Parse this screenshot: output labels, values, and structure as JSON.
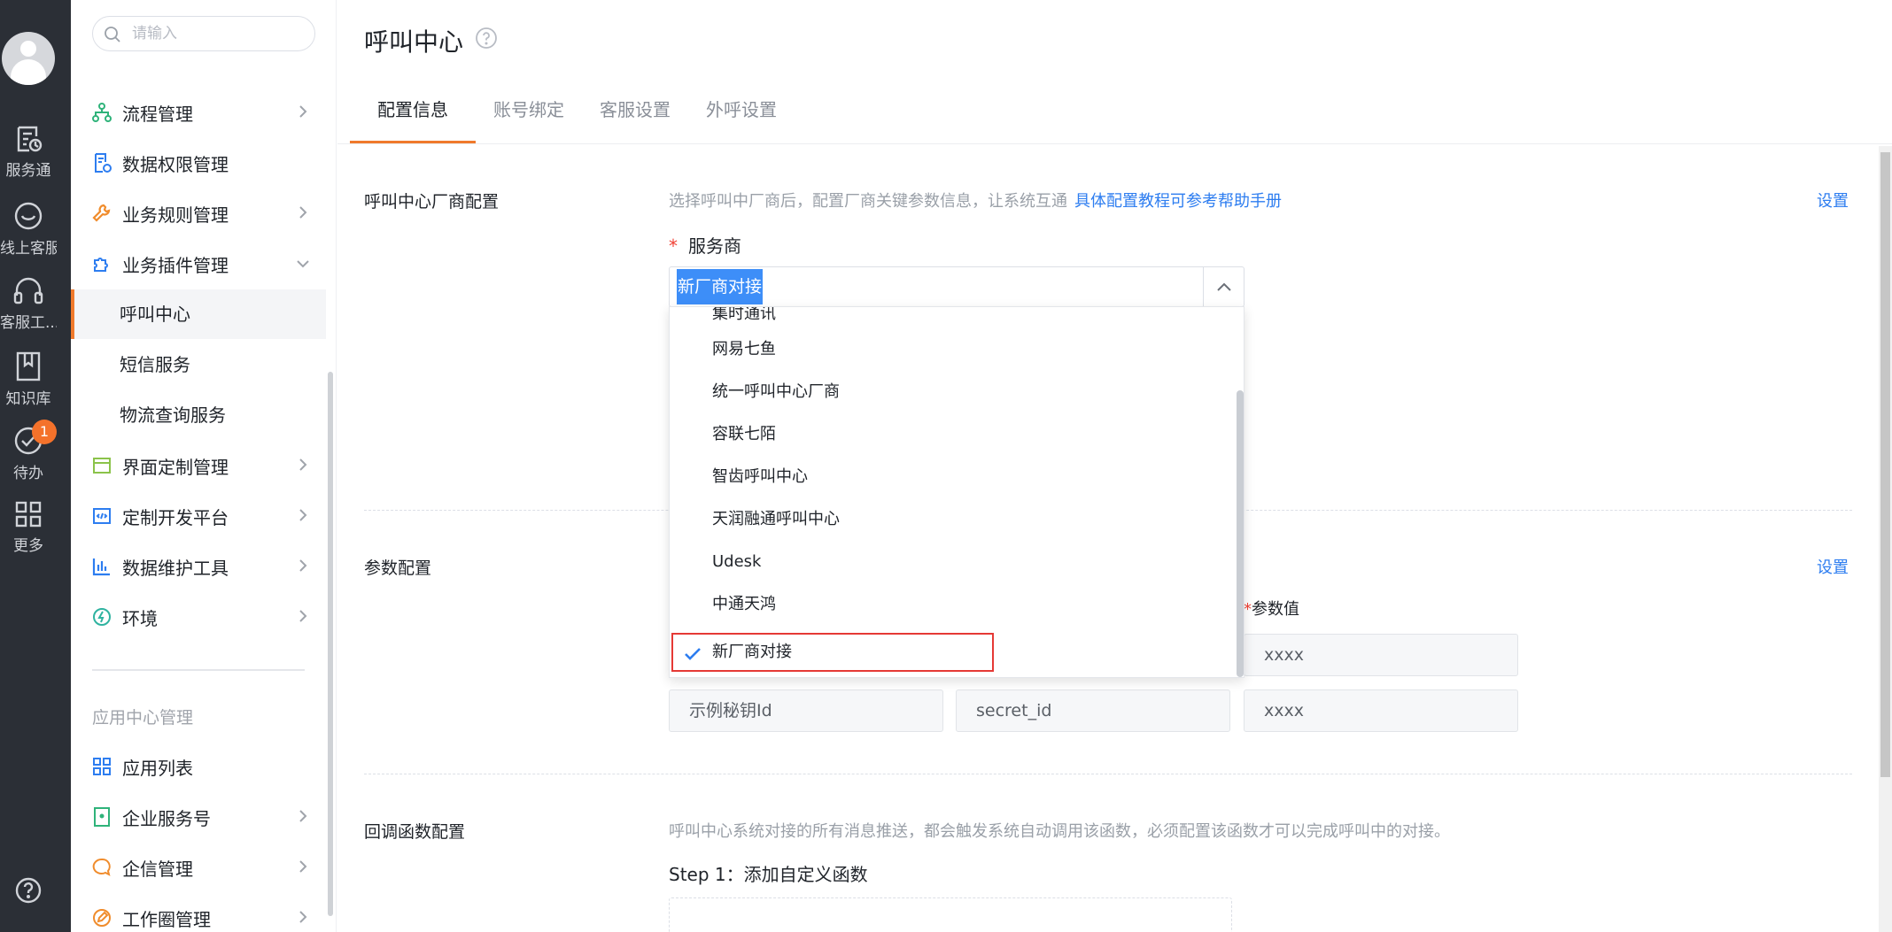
{
  "rail": {
    "items": [
      {
        "label": "服务通",
        "icon": "service-icon"
      },
      {
        "label": "线上客服",
        "icon": "chat-smile-icon"
      },
      {
        "label": "客服工...",
        "icon": "headset-icon"
      },
      {
        "label": "知识库",
        "icon": "book-icon"
      },
      {
        "label": "待办",
        "icon": "check-circle-icon",
        "badge": "1"
      },
      {
        "label": "更多",
        "icon": "grid-icon"
      }
    ],
    "help_icon": "help-icon"
  },
  "sidebar": {
    "search_placeholder": "请输入",
    "items": [
      {
        "label": "流程管理"
      },
      {
        "label": "数据权限管理"
      },
      {
        "label": "业务规则管理"
      },
      {
        "label": "业务插件管理"
      },
      {
        "label": "呼叫中心"
      },
      {
        "label": "短信服务"
      },
      {
        "label": "物流查询服务"
      },
      {
        "label": "界面定制管理"
      },
      {
        "label": "定制开发平台"
      },
      {
        "label": "数据维护工具"
      },
      {
        "label": "环境"
      }
    ],
    "group_title": "应用中心管理",
    "group_items": [
      {
        "label": "应用列表"
      },
      {
        "label": "企业服务号"
      },
      {
        "label": "企信管理"
      },
      {
        "label": "工作圈管理"
      }
    ]
  },
  "main": {
    "title": "呼叫中心",
    "tabs": [
      {
        "label": "配置信息",
        "active": true
      },
      {
        "label": "账号绑定"
      },
      {
        "label": "客服设置"
      },
      {
        "label": "外呼设置"
      }
    ],
    "vendor": {
      "label": "呼叫中心厂商配置",
      "desc": "选择呼叫中厂商后，配置厂商关键参数信息，让系统互通",
      "link": "具体配置教程可参考帮助手册",
      "set": "设置",
      "field_label": "服务商",
      "selected": "新厂商对接"
    },
    "dropdown": {
      "options": [
        "集时通讯",
        "网易七鱼",
        "统一呼叫中心厂商",
        "容联七陌",
        "智齿呼叫中心",
        "天润融通呼叫中心",
        "Udesk",
        "中通天鸿",
        "新厂商对接"
      ]
    },
    "params": {
      "label": "参数配置",
      "set": "设置",
      "value_header": "参数值",
      "rows": [
        {
          "value": "xxxx"
        },
        {
          "name": "示例秘钥Id",
          "key": "secret_id",
          "value": "xxxx"
        }
      ]
    },
    "callback": {
      "label": "回调函数配置",
      "desc": "呼叫中心系统对接的所有消息推送，都会触发系统自动调用该函数，必须配置该函数才可以完成呼叫中的对接。",
      "step": "Step 1：添加自定义函数"
    }
  }
}
